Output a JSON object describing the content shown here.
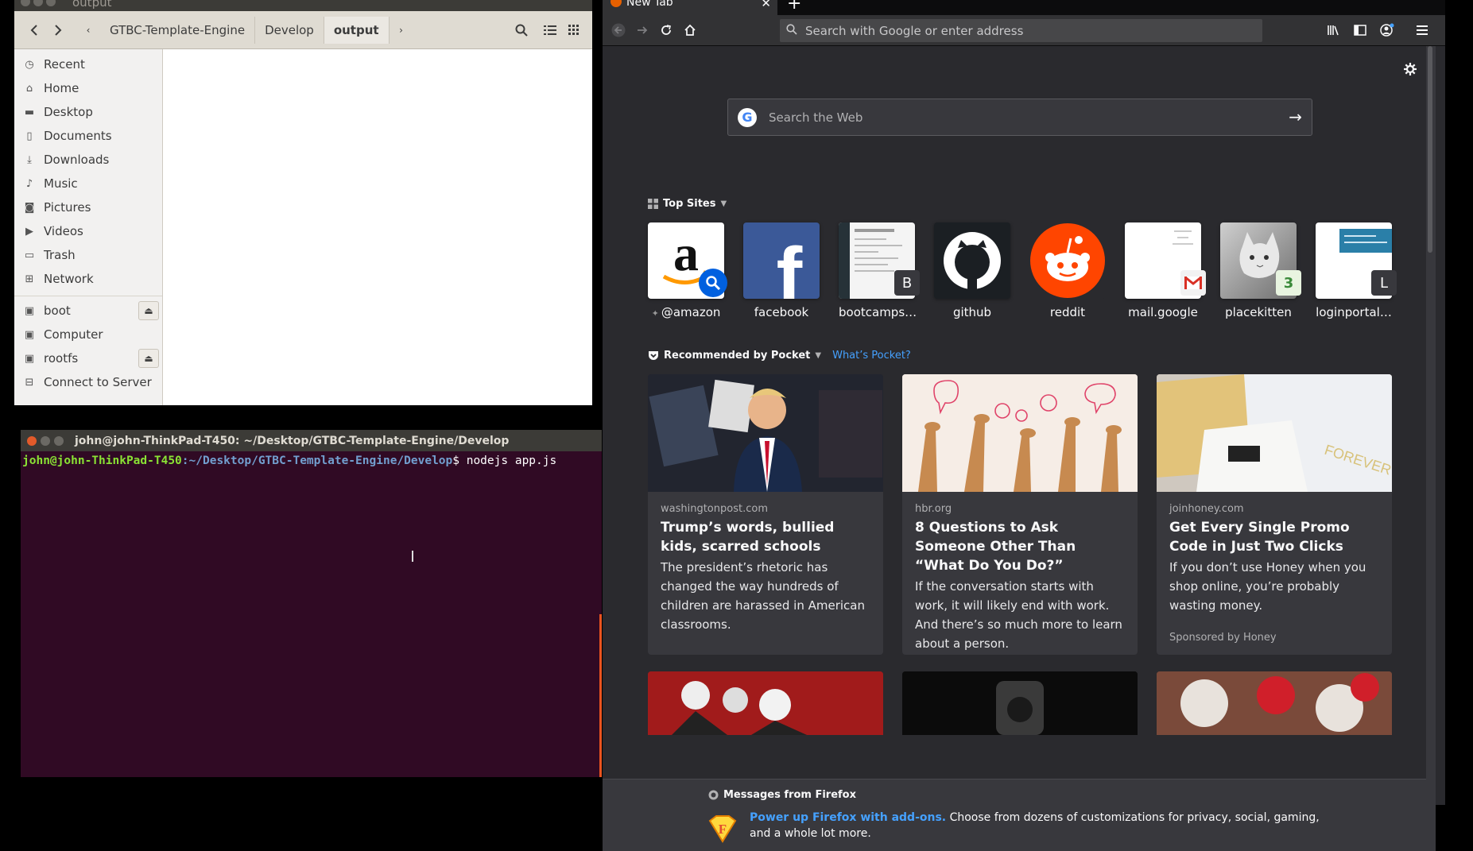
{
  "file_manager": {
    "title": "output",
    "breadcrumbs": [
      "GTBC-Template-Engine",
      "Develop",
      "output"
    ],
    "sidebar": [
      {
        "label": "Recent",
        "icon": "clock-icon"
      },
      {
        "label": "Home",
        "icon": "home-icon"
      },
      {
        "label": "Desktop",
        "icon": "folder-icon"
      },
      {
        "label": "Documents",
        "icon": "document-icon"
      },
      {
        "label": "Downloads",
        "icon": "download-icon"
      },
      {
        "label": "Music",
        "icon": "music-icon"
      },
      {
        "label": "Pictures",
        "icon": "camera-icon"
      },
      {
        "label": "Videos",
        "icon": "video-icon"
      },
      {
        "label": "Trash",
        "icon": "trash-icon"
      },
      {
        "label": "Network",
        "icon": "network-icon"
      }
    ],
    "devices": [
      {
        "label": "boot",
        "icon": "drive-icon",
        "eject": true
      },
      {
        "label": "Computer",
        "icon": "computer-icon",
        "eject": false
      },
      {
        "label": "rootfs",
        "icon": "drive-icon",
        "eject": true
      },
      {
        "label": "Connect to Server",
        "icon": "server-icon",
        "eject": false
      }
    ]
  },
  "terminal": {
    "title": "john@john-ThinkPad-T450: ~/Desktop/GTBC-Template-Engine/Develop",
    "prompt_user": "john@john-ThinkPad-T450",
    "prompt_path": ":~/Desktop/GTBC-Template-Engine/Develop",
    "command": "$ nodejs app.js"
  },
  "firefox": {
    "tab_title": "New Tab",
    "urlbar_placeholder": "Search with Google or enter address",
    "search_placeholder": "Search the Web",
    "top_sites_heading": "Top Sites",
    "top_sites": [
      {
        "label": "@amazon",
        "badge": ""
      },
      {
        "label": "facebook",
        "badge": ""
      },
      {
        "label": "bootcamps…",
        "badge": "B"
      },
      {
        "label": "github",
        "badge": ""
      },
      {
        "label": "reddit",
        "badge": ""
      },
      {
        "label": "mail.google",
        "badge": ""
      },
      {
        "label": "placekitten",
        "badge": ""
      },
      {
        "label": "loginportal…",
        "badge": "L"
      }
    ],
    "pocket_heading": "Recommended by Pocket",
    "pocket_link": "What’s Pocket?",
    "cards": [
      {
        "source": "washingtonpost.com",
        "title": "Trump’s words, bullied kids, scarred schools",
        "desc": "The president’s rhetoric has changed the way hundreds of children are harassed in American classrooms.",
        "sponsor": ""
      },
      {
        "source": "hbr.org",
        "title": "8 Questions to Ask Someone Other Than “What Do You Do?”",
        "desc": "If the conversation starts with work, it will likely end with work. And there’s so much more to learn about a person.",
        "sponsor": ""
      },
      {
        "source": "joinhoney.com",
        "title": "Get Every Single Promo Code in Just Two Clicks",
        "desc": "If you don’t use Honey when you shop online, you’re probably wasting money.",
        "sponsor": "Sponsored by Honey"
      }
    ],
    "messages_heading": "Messages from Firefox",
    "message_link": "Power up Firefox with add-ons.",
    "message_text": " Choose from dozens of customizations for privacy, social, gaming, and a whole lot more."
  }
}
